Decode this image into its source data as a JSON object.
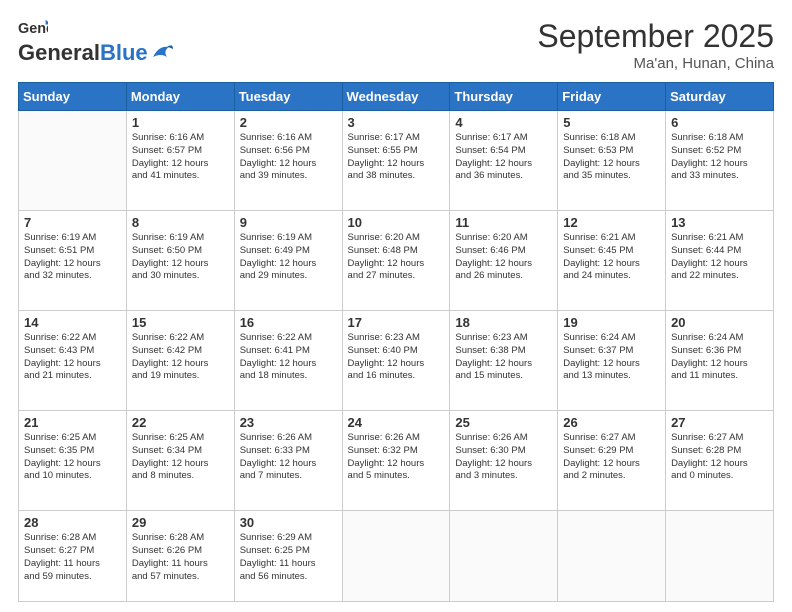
{
  "header": {
    "logo_general": "General",
    "logo_blue": "Blue",
    "month_title": "September 2025",
    "location": "Ma'an, Hunan, China"
  },
  "weekdays": [
    "Sunday",
    "Monday",
    "Tuesday",
    "Wednesday",
    "Thursday",
    "Friday",
    "Saturday"
  ],
  "weeks": [
    [
      {
        "day": "",
        "info": ""
      },
      {
        "day": "1",
        "info": "Sunrise: 6:16 AM\nSunset: 6:57 PM\nDaylight: 12 hours\nand 41 minutes."
      },
      {
        "day": "2",
        "info": "Sunrise: 6:16 AM\nSunset: 6:56 PM\nDaylight: 12 hours\nand 39 minutes."
      },
      {
        "day": "3",
        "info": "Sunrise: 6:17 AM\nSunset: 6:55 PM\nDaylight: 12 hours\nand 38 minutes."
      },
      {
        "day": "4",
        "info": "Sunrise: 6:17 AM\nSunset: 6:54 PM\nDaylight: 12 hours\nand 36 minutes."
      },
      {
        "day": "5",
        "info": "Sunrise: 6:18 AM\nSunset: 6:53 PM\nDaylight: 12 hours\nand 35 minutes."
      },
      {
        "day": "6",
        "info": "Sunrise: 6:18 AM\nSunset: 6:52 PM\nDaylight: 12 hours\nand 33 minutes."
      }
    ],
    [
      {
        "day": "7",
        "info": "Sunrise: 6:19 AM\nSunset: 6:51 PM\nDaylight: 12 hours\nand 32 minutes."
      },
      {
        "day": "8",
        "info": "Sunrise: 6:19 AM\nSunset: 6:50 PM\nDaylight: 12 hours\nand 30 minutes."
      },
      {
        "day": "9",
        "info": "Sunrise: 6:19 AM\nSunset: 6:49 PM\nDaylight: 12 hours\nand 29 minutes."
      },
      {
        "day": "10",
        "info": "Sunrise: 6:20 AM\nSunset: 6:48 PM\nDaylight: 12 hours\nand 27 minutes."
      },
      {
        "day": "11",
        "info": "Sunrise: 6:20 AM\nSunset: 6:46 PM\nDaylight: 12 hours\nand 26 minutes."
      },
      {
        "day": "12",
        "info": "Sunrise: 6:21 AM\nSunset: 6:45 PM\nDaylight: 12 hours\nand 24 minutes."
      },
      {
        "day": "13",
        "info": "Sunrise: 6:21 AM\nSunset: 6:44 PM\nDaylight: 12 hours\nand 22 minutes."
      }
    ],
    [
      {
        "day": "14",
        "info": "Sunrise: 6:22 AM\nSunset: 6:43 PM\nDaylight: 12 hours\nand 21 minutes."
      },
      {
        "day": "15",
        "info": "Sunrise: 6:22 AM\nSunset: 6:42 PM\nDaylight: 12 hours\nand 19 minutes."
      },
      {
        "day": "16",
        "info": "Sunrise: 6:22 AM\nSunset: 6:41 PM\nDaylight: 12 hours\nand 18 minutes."
      },
      {
        "day": "17",
        "info": "Sunrise: 6:23 AM\nSunset: 6:40 PM\nDaylight: 12 hours\nand 16 minutes."
      },
      {
        "day": "18",
        "info": "Sunrise: 6:23 AM\nSunset: 6:38 PM\nDaylight: 12 hours\nand 15 minutes."
      },
      {
        "day": "19",
        "info": "Sunrise: 6:24 AM\nSunset: 6:37 PM\nDaylight: 12 hours\nand 13 minutes."
      },
      {
        "day": "20",
        "info": "Sunrise: 6:24 AM\nSunset: 6:36 PM\nDaylight: 12 hours\nand 11 minutes."
      }
    ],
    [
      {
        "day": "21",
        "info": "Sunrise: 6:25 AM\nSunset: 6:35 PM\nDaylight: 12 hours\nand 10 minutes."
      },
      {
        "day": "22",
        "info": "Sunrise: 6:25 AM\nSunset: 6:34 PM\nDaylight: 12 hours\nand 8 minutes."
      },
      {
        "day": "23",
        "info": "Sunrise: 6:26 AM\nSunset: 6:33 PM\nDaylight: 12 hours\nand 7 minutes."
      },
      {
        "day": "24",
        "info": "Sunrise: 6:26 AM\nSunset: 6:32 PM\nDaylight: 12 hours\nand 5 minutes."
      },
      {
        "day": "25",
        "info": "Sunrise: 6:26 AM\nSunset: 6:30 PM\nDaylight: 12 hours\nand 3 minutes."
      },
      {
        "day": "26",
        "info": "Sunrise: 6:27 AM\nSunset: 6:29 PM\nDaylight: 12 hours\nand 2 minutes."
      },
      {
        "day": "27",
        "info": "Sunrise: 6:27 AM\nSunset: 6:28 PM\nDaylight: 12 hours\nand 0 minutes."
      }
    ],
    [
      {
        "day": "28",
        "info": "Sunrise: 6:28 AM\nSunset: 6:27 PM\nDaylight: 11 hours\nand 59 minutes."
      },
      {
        "day": "29",
        "info": "Sunrise: 6:28 AM\nSunset: 6:26 PM\nDaylight: 11 hours\nand 57 minutes."
      },
      {
        "day": "30",
        "info": "Sunrise: 6:29 AM\nSunset: 6:25 PM\nDaylight: 11 hours\nand 56 minutes."
      },
      {
        "day": "",
        "info": ""
      },
      {
        "day": "",
        "info": ""
      },
      {
        "day": "",
        "info": ""
      },
      {
        "day": "",
        "info": ""
      }
    ]
  ]
}
